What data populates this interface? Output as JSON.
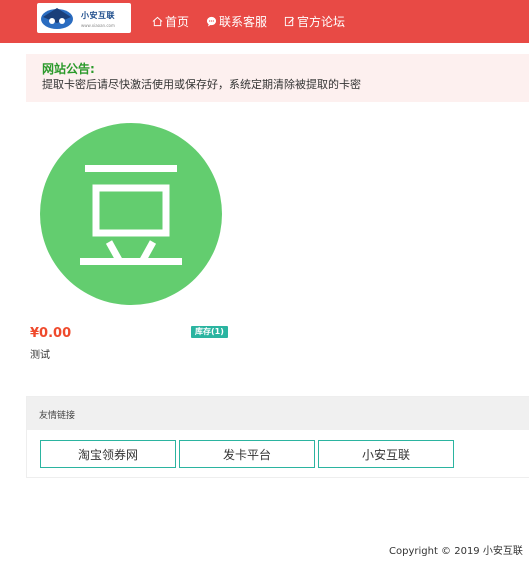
{
  "header": {
    "logo": {
      "title": "小安互联",
      "subtitle": "www.xiaoan.com"
    },
    "nav": [
      {
        "label": "首页",
        "icon": "home-icon"
      },
      {
        "label": "联系客服",
        "icon": "chat-icon"
      },
      {
        "label": "官方论坛",
        "icon": "edit-icon"
      }
    ]
  },
  "notice": {
    "title": "网站公告:",
    "text": "提取卡密后请尽快激活使用或保存好，系统定期清除被提取的卡密"
  },
  "product": {
    "image_char": "豆",
    "image_color": "#63cd6f",
    "price": "¥0.00",
    "stock": "库存(1)",
    "name": "测试"
  },
  "links": {
    "title": "友情链接",
    "items": [
      "淘宝领券网",
      "发卡平台",
      "小安互联"
    ]
  },
  "footer": {
    "copyright": "Copyright © 2019 小安互联"
  },
  "colors": {
    "header": "#e84a45",
    "accent": "#2bb4a0",
    "price": "#ef4a2c",
    "notice_title": "#2b9a2b"
  }
}
